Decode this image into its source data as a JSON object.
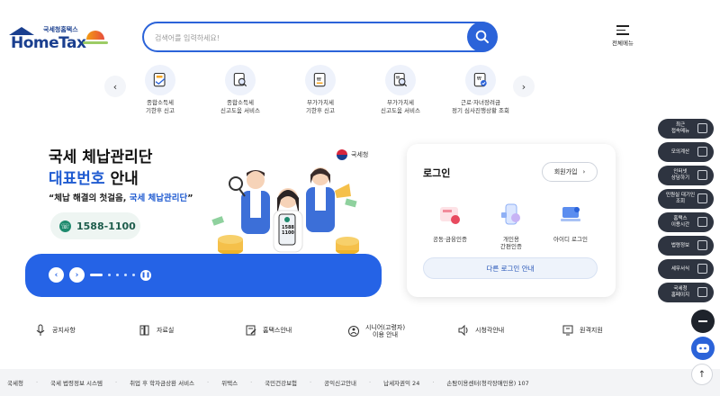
{
  "header": {
    "logo_small": "국세청홈택스",
    "logo_main": "HomeTax",
    "search_placeholder": "검색어를 입력하세요!",
    "menu_label": "전체메뉴"
  },
  "quick_services": [
    {
      "label": "종합소득세\n기한후 신고",
      "icon": "tax-file-icon"
    },
    {
      "label": "종합소득세\n신고도움 서비스",
      "icon": "document-search-icon"
    },
    {
      "label": "부가가치세\n기한후 신고",
      "icon": "vat-file-icon"
    },
    {
      "label": "부가가치세\n신고도움 서비스",
      "icon": "vat-search-icon"
    },
    {
      "label": "근로·자녀장려금\n정기 심사진행상황 조회",
      "icon": "incentive-check-icon"
    }
  ],
  "hero": {
    "title_line1": "국세 체납관리단",
    "title_line2_highlight": "대표번호",
    "title_line2_rest": " 안내",
    "subtitle_prefix": "“체납 해결의 첫걸음, ",
    "subtitle_highlight": "국세 체납관리단",
    "subtitle_suffix": "”",
    "phone": "1588-1100",
    "agency": "국세청",
    "sign_text": "1588\n1100"
  },
  "login": {
    "title": "로그인",
    "join_label": "회원가입",
    "options": [
      {
        "label": "공동·금융인증",
        "color": "#f28b9b"
      },
      {
        "label": "개인용\n간편인증",
        "color": "#8fb0f5"
      },
      {
        "label": "아이디 로그인",
        "color": "#5b8def"
      }
    ],
    "other_label": "다른 로그인 안내"
  },
  "side_menu": [
    {
      "label": "최근\n접속메뉴"
    },
    {
      "label": "모의계산"
    },
    {
      "label": "인터넷\n상담하기"
    },
    {
      "label": "민원실 대기인\n조회"
    },
    {
      "label": "홈택스\n이용시간"
    },
    {
      "label": "법령정보"
    },
    {
      "label": "세무서식"
    },
    {
      "label": "국세청\n홈페이지"
    }
  ],
  "bottom_nav": [
    {
      "label": "공지사항",
      "icon": "microphone-icon"
    },
    {
      "label": "자료실",
      "icon": "archive-icon"
    },
    {
      "label": "홈택스안내",
      "icon": "edit-doc-icon"
    },
    {
      "label": "시니어(고령자)\n이용 안내",
      "icon": "senior-icon"
    },
    {
      "label": "시청각안내",
      "icon": "speaker-icon"
    },
    {
      "label": "원격지원",
      "icon": "remote-support-icon"
    }
  ],
  "footer_links": [
    "국세청",
    "국세 법령정보 시스템",
    "취업 후 학자금상환 서비스",
    "위택스",
    "국민건강보험",
    "공익신고안내",
    "납세자권익 24",
    "손탐이용센터(청각장애인용) 107"
  ],
  "colors": {
    "primary": "#2b63d9",
    "band": "#2563e6",
    "dark_fab": "#2e3440",
    "phone_green": "#1e8a6e"
  }
}
